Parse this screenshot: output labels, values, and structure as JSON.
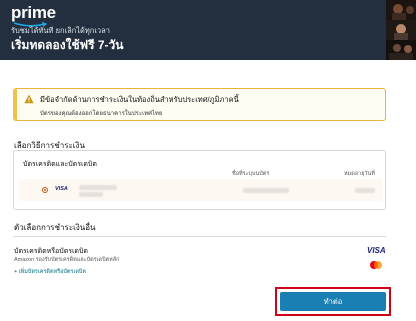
{
  "header": {
    "brand": "prime",
    "subtitle": "รับชมได้ทันที ยกเลิกได้ทุกเวลา",
    "headline": "เริ่มทดลองใช้ฟรี 7-วัน"
  },
  "warning": {
    "title": "มีข้อจำกัดด้านการชำระเงินในท้องถิ่นสำหรับประเทศ/ภูมิภาคนี้",
    "body": "บัตรของคุณต้องออกโดยธนาคารในประเทศไทย"
  },
  "payment": {
    "section_title": "เลือกวิธีการชำระเงิน",
    "card_box_title": "บัตรเครดิตและบัตรเดบิต",
    "col_name": "ชื่อที่ระบุบนบัตร",
    "col_expiry": "หมดอายุวันที่",
    "card_brand": "VISA"
  },
  "other": {
    "section_title": "ตัวเลือกการชำระเงินอื่น",
    "title": "บัตรเครดิตหรือบัตรเดบิต",
    "subtitle": "Amazon รองรับบัตรเครดิตและบัตรเดบิตหลัก",
    "add_link": "+ เพิ่มบัตรเครดิตหรือบัตรเดบิต",
    "visa": "VISA"
  },
  "actions": {
    "continue_label": "ทำต่อ"
  },
  "colors": {
    "header_bg": "#232f3e",
    "button": "#1a7fb3",
    "highlight_frame": "#d0021b",
    "warning_border": "#f0c14b"
  }
}
